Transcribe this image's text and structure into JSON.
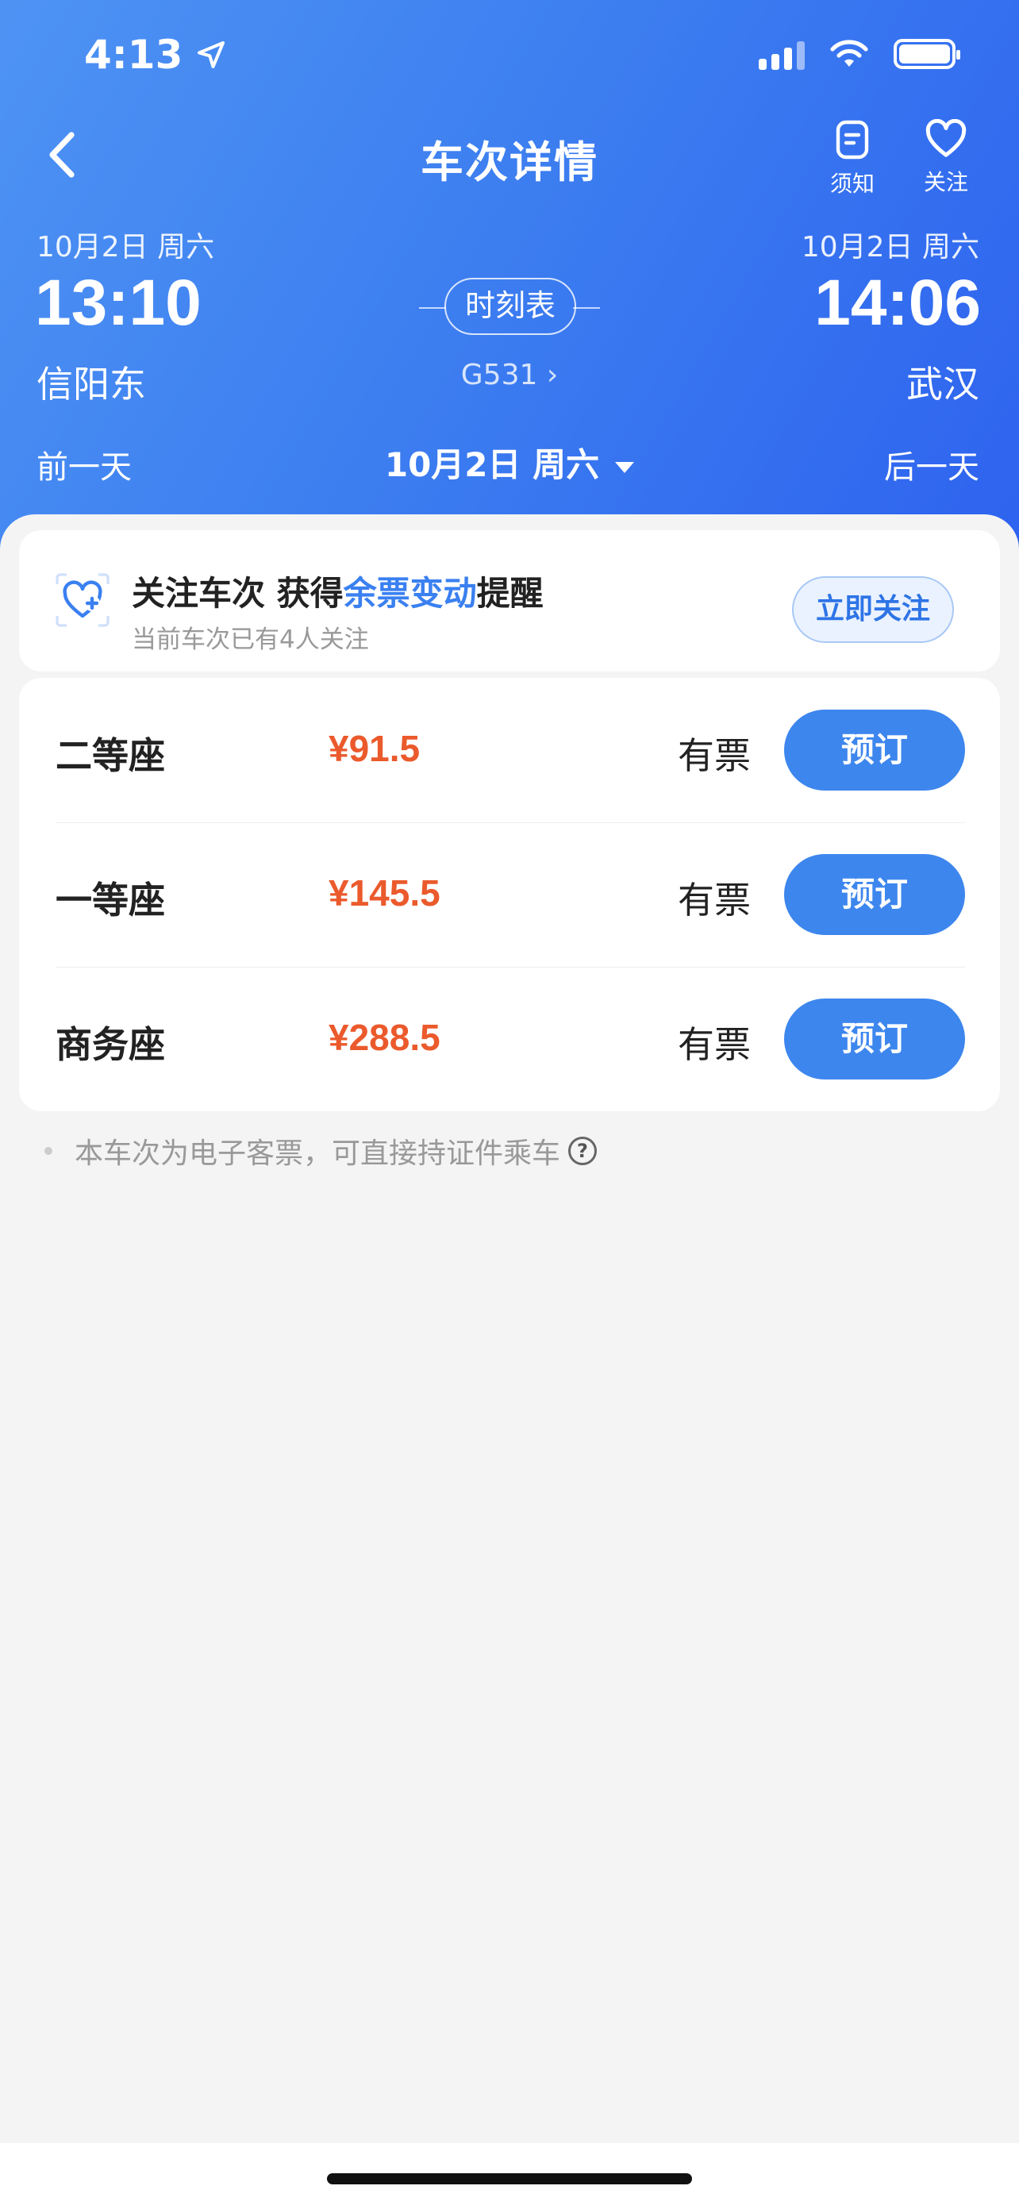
{
  "status_bar": {
    "time": "4:13"
  },
  "nav": {
    "title": "车次详情",
    "notice_label": "须知",
    "follow_label": "关注"
  },
  "trip": {
    "depart": {
      "date": "10月2日 周六",
      "time": "13:10",
      "station": "信阳东"
    },
    "arrive": {
      "date": "10月2日 周六",
      "time": "14:06",
      "station": "武汉"
    },
    "timetable_label": "时刻表",
    "train_number": "G531"
  },
  "day_nav": {
    "prev": "前一天",
    "current": "10月2日 周六",
    "next": "后一天"
  },
  "follow_card": {
    "title_prefix": "关注车次 获得",
    "title_highlight": "余票变动",
    "title_suffix": "提醒",
    "subtitle": "当前车次已有4人关注",
    "button": "立即关注"
  },
  "seats": [
    {
      "name": "二等座",
      "price": "¥91.5",
      "availability": "有票",
      "button": "预订"
    },
    {
      "name": "一等座",
      "price": "¥145.5",
      "availability": "有票",
      "button": "预订"
    },
    {
      "name": "商务座",
      "price": "¥288.5",
      "availability": "有票",
      "button": "预订"
    }
  ],
  "note": "本车次为电子客票，可直接持证件乘车",
  "colors": {
    "header": "#3d7ff0",
    "accent": "#3d86ee",
    "price": "#eb5a2c"
  }
}
